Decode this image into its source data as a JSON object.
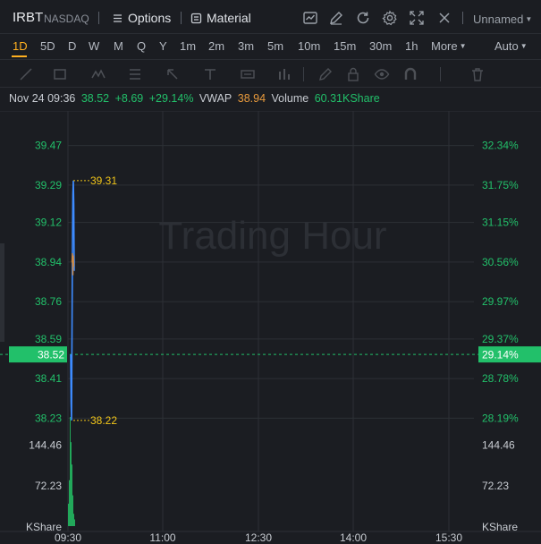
{
  "toolbar": {
    "symbol": "IRBT",
    "exchange": "NASDAQ",
    "options_label": "Options",
    "material_label": "Material",
    "icons": [
      "chart-type-icon",
      "draw-icon",
      "refresh-icon",
      "settings-icon",
      "fullscreen-icon",
      "close-icon"
    ],
    "layout_label": "Unnamed"
  },
  "timeframes": {
    "items": [
      "1D",
      "5D",
      "D",
      "W",
      "M",
      "Q",
      "Y",
      "1m",
      "2m",
      "3m",
      "5m",
      "10m",
      "15m",
      "30m",
      "1h"
    ],
    "active": "1D",
    "more_label": "More",
    "auto_label": "Auto"
  },
  "drawing_tools": [
    "line-tool-icon",
    "rectangle-tool-icon",
    "pattern-tool-icon",
    "fib-tool-icon",
    "arrow-tool-icon",
    "text-tool-icon",
    "measure-tool-icon",
    "bars-tool-icon",
    "pencil-icon",
    "lock-icon",
    "eye-icon",
    "magnet-icon",
    "trash-icon"
  ],
  "quote": {
    "datetime": "Nov 24 09:36",
    "price": "38.52",
    "change": "+8.69",
    "change_pct": "+29.14%",
    "vwap_label": "VWAP",
    "vwap": "38.94",
    "volume_label": "Volume",
    "volume": "60.31KShare"
  },
  "chart_data": {
    "type": "line",
    "watermark": "Trading Hour",
    "price_axis": [
      "39.47",
      "39.29",
      "39.12",
      "38.94",
      "38.76",
      "38.59",
      "38.41",
      "38.23"
    ],
    "pct_axis": [
      "32.34%",
      "31.75%",
      "31.15%",
      "30.56%",
      "29.97%",
      "29.37%",
      "28.78%",
      "28.19%"
    ],
    "current_price": "38.52",
    "current_pct": "29.14%",
    "high_label": "39.31",
    "low_label": "38.22",
    "ylim": [
      38.13,
      39.57
    ],
    "volume_axis": [
      "144.46",
      "72.23"
    ],
    "volume_unit": "KShare",
    "volume_ylim": [
      0,
      195
    ],
    "x_ticks": [
      "09:30",
      "11:00",
      "12:30",
      "14:00",
      "15:30"
    ],
    "series": [
      {
        "values": [
          38.52,
          38.3,
          38.22,
          38.6,
          39.0,
          39.25,
          39.31,
          39.2,
          38.9
        ]
      },
      {
        "values": [
          38.94,
          38.94,
          38.98,
          38.88,
          38.97,
          38.92
        ]
      }
    ],
    "volume": [
      40,
      82,
      195,
      150,
      110,
      55,
      22,
      12
    ],
    "colors": {
      "price": "#3d8bff",
      "vwap": "#c98a4a",
      "up": "#22c06a",
      "high_low": "#f0c419",
      "volume": "#22a85a",
      "grid": "#2d3036"
    }
  }
}
